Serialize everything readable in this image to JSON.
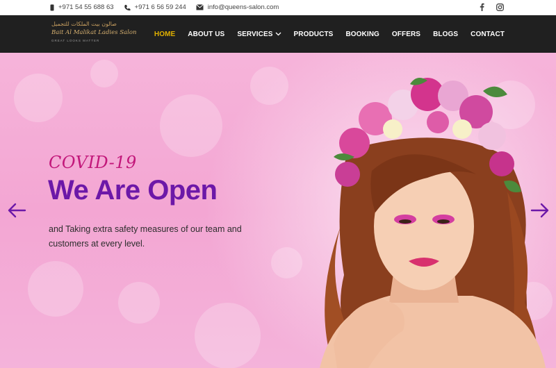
{
  "topbar": {
    "phone_1": "+971 54 55 688 63",
    "phone_2": "+971 6 56 59 244",
    "email": "info@queens-salon.com",
    "social": [
      "facebook-icon",
      "instagram-icon"
    ]
  },
  "logo": {
    "arabic": "صالون بيت الملكات للتجميل",
    "english": "Bait Al Malikat Ladies Salon",
    "tagline": "GREAT LOOKS MATTER"
  },
  "nav": {
    "items": [
      {
        "label": "HOME",
        "active": true
      },
      {
        "label": "ABOUT US",
        "active": false
      },
      {
        "label": "SERVICES",
        "active": false,
        "has_dropdown": true
      },
      {
        "label": "PRODUCTS",
        "active": false
      },
      {
        "label": "BOOKING",
        "active": false
      },
      {
        "label": "OFFERS",
        "active": false
      },
      {
        "label": "BLOGS",
        "active": false
      },
      {
        "label": "CONTACT",
        "active": false
      }
    ],
    "active_color": "#e0b000"
  },
  "hero": {
    "kicker": "COVID-19",
    "headline": "We Are Open",
    "description": "and Taking extra safety measures of our team and customers at every level.",
    "prev_icon": "arrow-left-icon",
    "next_icon": "arrow-right-icon",
    "colors": {
      "kicker": "#c2177a",
      "headline": "#6c18a8",
      "arrows": "#6c18a8",
      "background": "#f5aed7"
    }
  }
}
